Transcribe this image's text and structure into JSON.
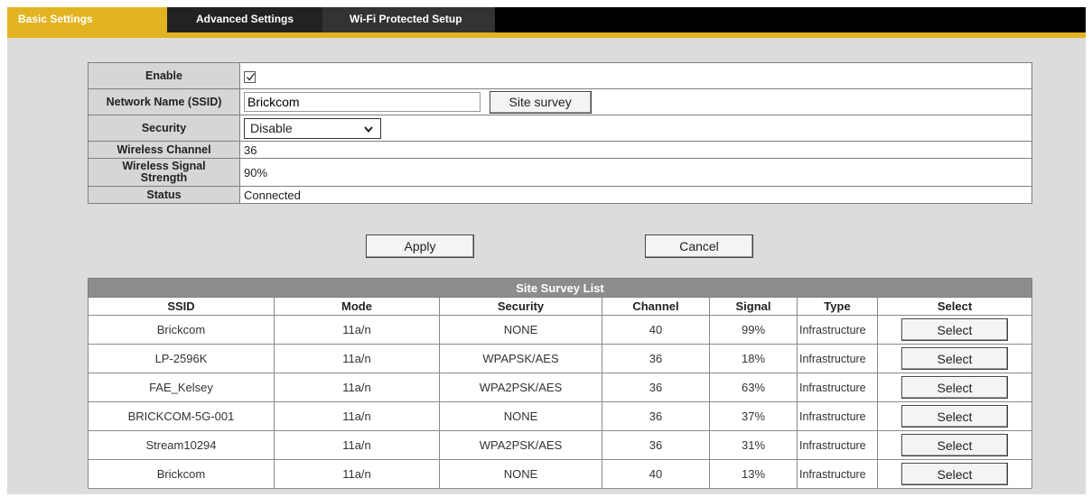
{
  "tabs": [
    {
      "label": "Basic Settings",
      "active": true
    },
    {
      "label": "Advanced Settings",
      "active": false
    },
    {
      "label": "Wi-Fi Protected Setup",
      "active": false
    }
  ],
  "settings": {
    "enable_label": "Enable",
    "enable_checked": true,
    "ssid_label": "Network Name (SSID)",
    "ssid_value": "Brickcom",
    "site_survey_button": "Site survey",
    "security_label": "Security",
    "security_value": "Disable",
    "channel_label": "Wireless Channel",
    "channel_value": "36",
    "signal_label_line1": "Wireless Signal",
    "signal_label_line2": "Strength",
    "signal_value": "90%",
    "status_label": "Status",
    "status_value": "Connected"
  },
  "actions": {
    "apply": "Apply",
    "cancel": "Cancel"
  },
  "survey": {
    "title": "Site Survey List",
    "columns": [
      "SSID",
      "Mode",
      "Security",
      "Channel",
      "Signal",
      "Type",
      "Select"
    ],
    "rows": [
      {
        "ssid": "Brickcom",
        "mode": "11a/n",
        "security": "NONE",
        "channel": "40",
        "signal": "99%",
        "type": "Infrastructure",
        "select": "Select"
      },
      {
        "ssid": "LP-2596K",
        "mode": "11a/n",
        "security": "WPAPSK/AES",
        "channel": "36",
        "signal": "18%",
        "type": "Infrastructure",
        "select": "Select"
      },
      {
        "ssid": "FAE_Kelsey",
        "mode": "11a/n",
        "security": "WPA2PSK/AES",
        "channel": "36",
        "signal": "63%",
        "type": "Infrastructure",
        "select": "Select"
      },
      {
        "ssid": "BRICKCOM-5G-001",
        "mode": "11a/n",
        "security": "NONE",
        "channel": "36",
        "signal": "37%",
        "type": "Infrastructure",
        "select": "Select"
      },
      {
        "ssid": "Stream10294",
        "mode": "11a/n",
        "security": "WPA2PSK/AES",
        "channel": "36",
        "signal": "31%",
        "type": "Infrastructure",
        "select": "Select"
      },
      {
        "ssid": "Brickcom",
        "mode": "11a/n",
        "security": "NONE",
        "channel": "40",
        "signal": "13%",
        "type": "Infrastructure",
        "select": "Select"
      }
    ]
  },
  "colors": {
    "accent": "#e3b421",
    "tabbar": "#000000",
    "panel": "#dcdcdc",
    "header_grey": "#8d8d8d"
  }
}
